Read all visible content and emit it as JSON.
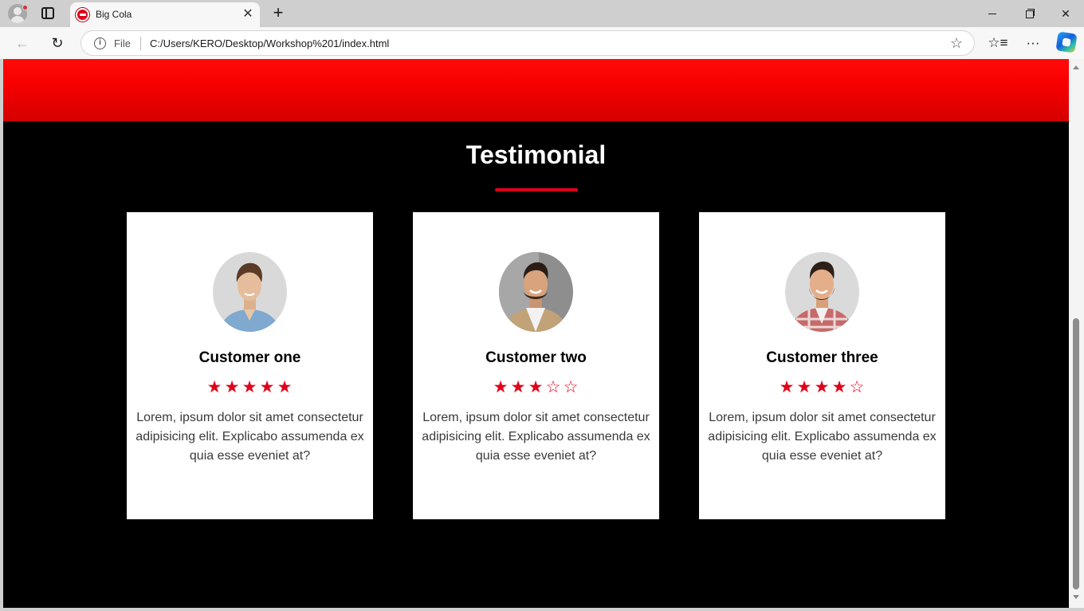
{
  "browser": {
    "tab_title": "Big Cola",
    "address_prefix": "File",
    "url": "C:/Users/KERO/Desktop/Workshop%201/index.html",
    "icons": {
      "tab_close": "✕",
      "new_tab": "+",
      "back": "←",
      "reload": "↻",
      "info": "i",
      "favorite": "☆",
      "favorites_bar": "☆≡",
      "more": "···",
      "minimize": "",
      "restore": "",
      "close": "✕"
    }
  },
  "testimonial": {
    "title": "Testimonial",
    "accent_color": "#e0001a",
    "star_filled": "★",
    "star_empty": "☆",
    "customers": [
      {
        "name": "Customer one",
        "rating": 5,
        "max_rating": 5,
        "text": "Lorem, ipsum dolor sit amet consectetur adipisicing elit. Explicabo assumenda ex quia esse eveniet at?"
      },
      {
        "name": "Customer two",
        "rating": 3,
        "max_rating": 5,
        "text": "Lorem, ipsum dolor sit amet consectetur adipisicing elit. Explicabo assumenda ex quia esse eveniet at?"
      },
      {
        "name": "Customer three",
        "rating": 4,
        "max_rating": 5,
        "text": "Lorem, ipsum dolor sit amet consectetur adipisicing elit. Explicabo assumenda ex quia esse eveniet at?"
      }
    ]
  }
}
